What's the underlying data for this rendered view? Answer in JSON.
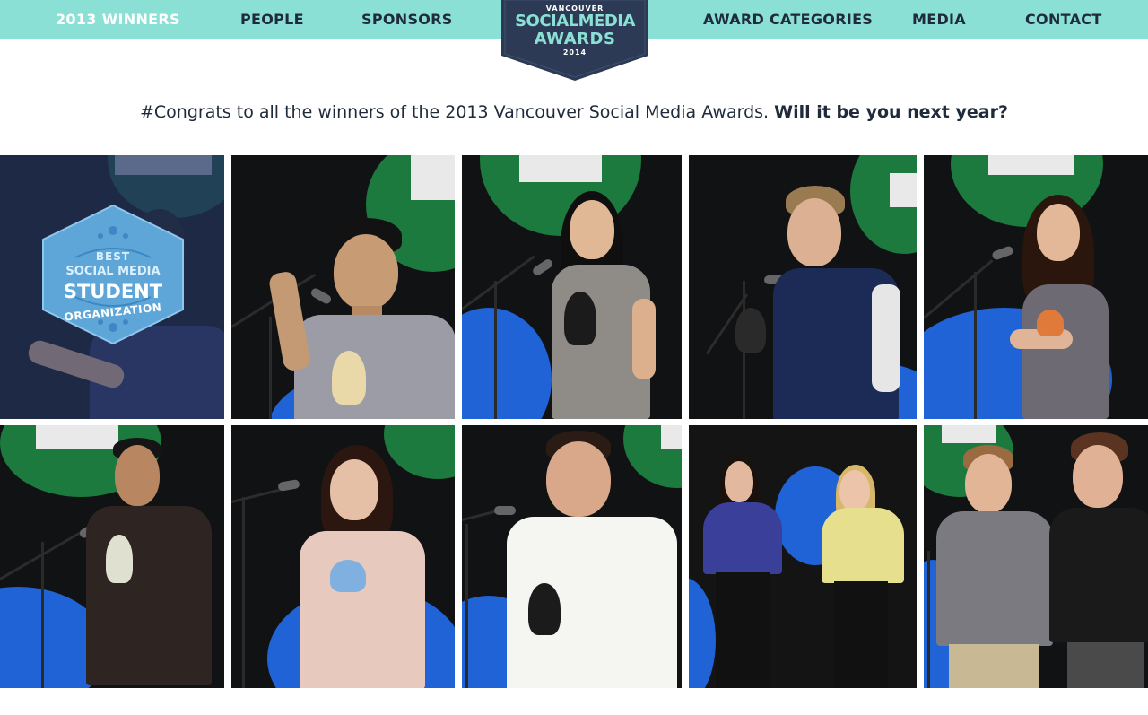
{
  "nav": {
    "items": [
      {
        "label": "2013 WINNERS"
      },
      {
        "label": "PEOPLE"
      },
      {
        "label": "SPONSORS"
      },
      {
        "label": "AWARD CATEGORIES"
      },
      {
        "label": "MEDIA"
      },
      {
        "label": "CONTACT"
      }
    ],
    "active_index": 0
  },
  "logo": {
    "small_top": "VANCOUVER",
    "line1": "SOCIALMEDIA",
    "line2": "AWARDS",
    "year": "2014"
  },
  "tagline": {
    "text": "#Congrats to all the winners of the 2013 Vancouver Social Media Awards.",
    "emphasis": "Will it be you next year?"
  },
  "award_overlay": {
    "line1": "BEST",
    "line2": "SOCIAL MEDIA",
    "line3": "STUDENT",
    "line4": "ORGANIZATION"
  },
  "colors": {
    "nav_bg": "#8be0d5",
    "nav_text": "#1f2a3a",
    "nav_active": "#ffffff",
    "logo_bg": "#2c3a55",
    "hex_fill": "#5ea6d8",
    "stage_green": "#1c7a3e",
    "stage_blue": "#1f63d6"
  }
}
